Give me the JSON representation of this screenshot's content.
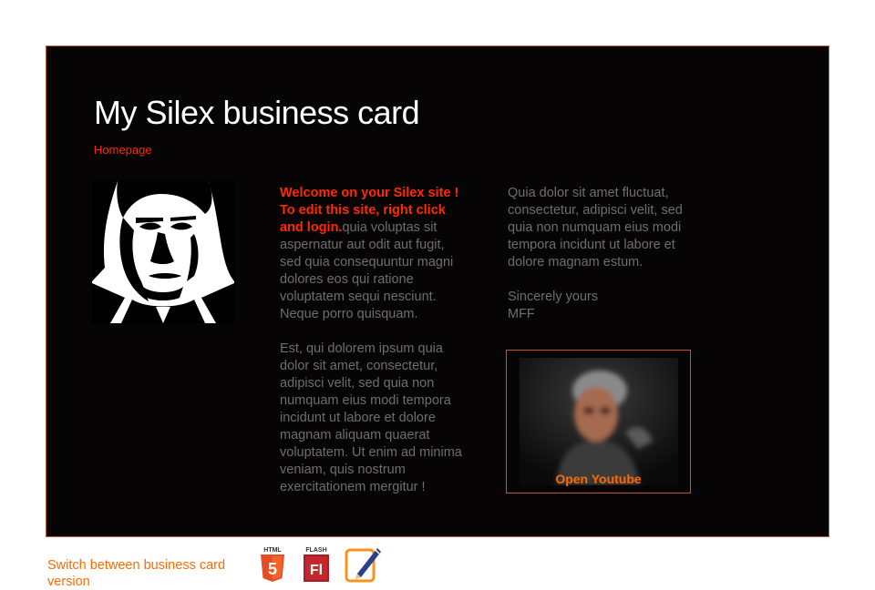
{
  "card": {
    "title": "My Silex business card",
    "home_link": "Homepage",
    "column1": {
      "welcome_highlight": "Welcome on your Silex site ! To edit this site, right click and login.",
      "paragraph1_rest": "quia voluptas sit aspernatur aut odit aut fugit, sed quia consequuntur magni dolores eos qui ratione voluptatem sequi nesciunt. Neque porro quisquam.",
      "paragraph2": "Est, qui dolorem ipsum quia dolor sit amet, consectetur, adipisci velit, sed quia non numquam eius modi tempora incidunt ut labore et dolore magnam aliquam quaerat voluptatem. Ut enim ad minima veniam, quis nostrum exercitationem mergitur !"
    },
    "column2": {
      "paragraph1": "Quia dolor sit amet fluctuat, consectetur, adipisci velit, sed quia non numquam eius modi tempora incidunt ut labore et dolore magnam estum.",
      "signoff": "Sincerely yours",
      "signature": "MFF"
    },
    "video": {
      "label": "Open Youtube"
    }
  },
  "footer": {
    "switch_text": "Switch between business card version",
    "icons": [
      {
        "name": "html5-icon",
        "top_text": "HTML",
        "glyph": "5",
        "color": "#e44d26"
      },
      {
        "name": "flash-icon",
        "top_text": "FLASH",
        "glyph": "Fl",
        "color": "#c1272d"
      },
      {
        "name": "edit-icon",
        "color": "#f7931e"
      }
    ]
  },
  "colors": {
    "card_background": "#060405",
    "border": "#c8552d",
    "title": "#ffffff",
    "highlight_red": "#ff2a00",
    "body_gray": "#6e6e6e",
    "orange": "#ff6a00"
  }
}
